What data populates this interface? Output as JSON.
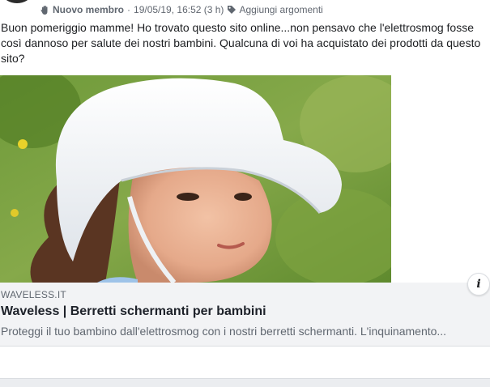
{
  "post": {
    "author_badge": "Nuovo membro",
    "separator": "·",
    "timestamp": "19/05/19, 16:52 (3 h)",
    "add_topics": "Aggiungi argomenti",
    "text": "Buon pomeriggio mamme! Ho trovato questo sito online...non pensavo che l'elettrosmog fosse così dannoso per salute dei nostri bambini. Qualcuna di voi ha acquistato dei prodotti da questo sito?"
  },
  "link_preview": {
    "domain": "WAVELESS.IT",
    "title": "Waveless | Berretti schermanti per bambini",
    "description": "Proteggi il tuo bambino dall'elettrosmog con i nostri berretti schermanti. L'inquinamento...",
    "info_label": "i"
  },
  "icons": {
    "badge": "new-member-hand-icon",
    "tag": "tag-icon",
    "info": "info-icon"
  }
}
